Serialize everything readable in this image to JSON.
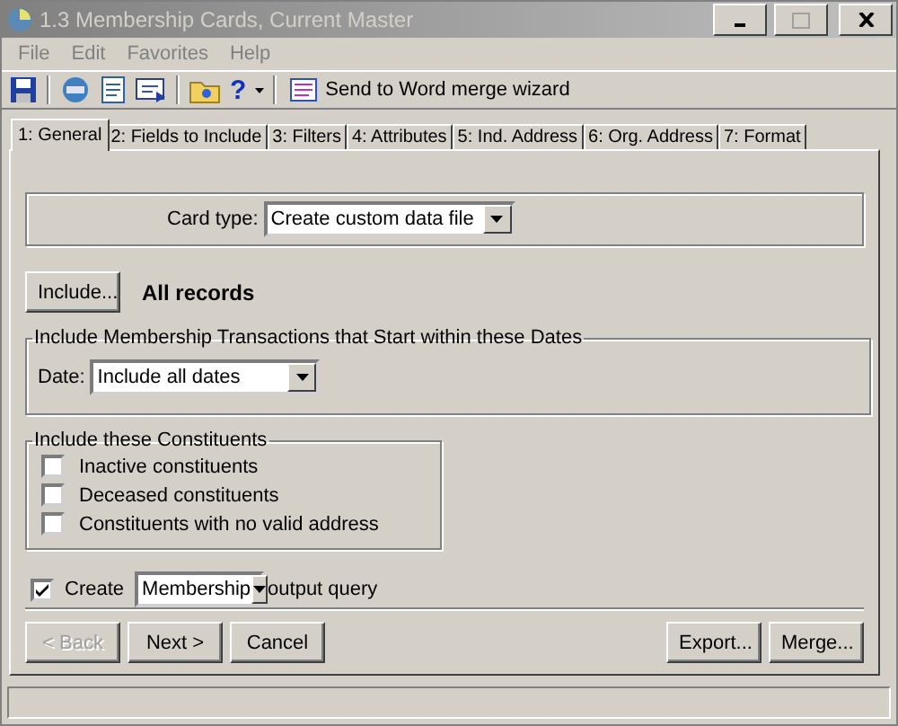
{
  "window": {
    "title": "1.3 Membership Cards, Current Master",
    "active": false
  },
  "menu": [
    "File",
    "Edit",
    "Favorites",
    "Help"
  ],
  "toolbar": {
    "help_glyph": "?",
    "merge_label": "Send to Word merge wizard"
  },
  "tabs": [
    {
      "label": "1: General",
      "selected": true
    },
    {
      "label": "2: Fields to Include",
      "selected": false
    },
    {
      "label": "3: Filters",
      "selected": false
    },
    {
      "label": "4: Attributes",
      "selected": false
    },
    {
      "label": "5: Ind. Address",
      "selected": false
    },
    {
      "label": "6: Org. Address",
      "selected": false
    },
    {
      "label": "7: Format",
      "selected": false
    }
  ],
  "card_type": {
    "label": "Card type:",
    "value": "Create custom data file"
  },
  "include": {
    "button": "Include...",
    "value": "All records"
  },
  "dates": {
    "title": "Include Membership Transactions that Start within these Dates",
    "label": "Date:",
    "value": "Include all dates"
  },
  "constituents": {
    "title": "Include these Constituents",
    "options": [
      {
        "label": "Inactive constituents",
        "checked": false
      },
      {
        "label": "Deceased constituents",
        "checked": false
      },
      {
        "label": "Constituents with no valid address",
        "checked": false
      }
    ]
  },
  "output": {
    "checked": true,
    "label": "Create",
    "value": "Membership",
    "suffix": "output query"
  },
  "buttons_left": [
    {
      "label": "< Back",
      "disabled": true
    },
    {
      "label": "Next >",
      "disabled": false
    },
    {
      "label": "Cancel",
      "disabled": false
    }
  ],
  "buttons_right": [
    {
      "label": "Export...",
      "disabled": false
    },
    {
      "label": "Merge...",
      "disabled": false
    }
  ]
}
